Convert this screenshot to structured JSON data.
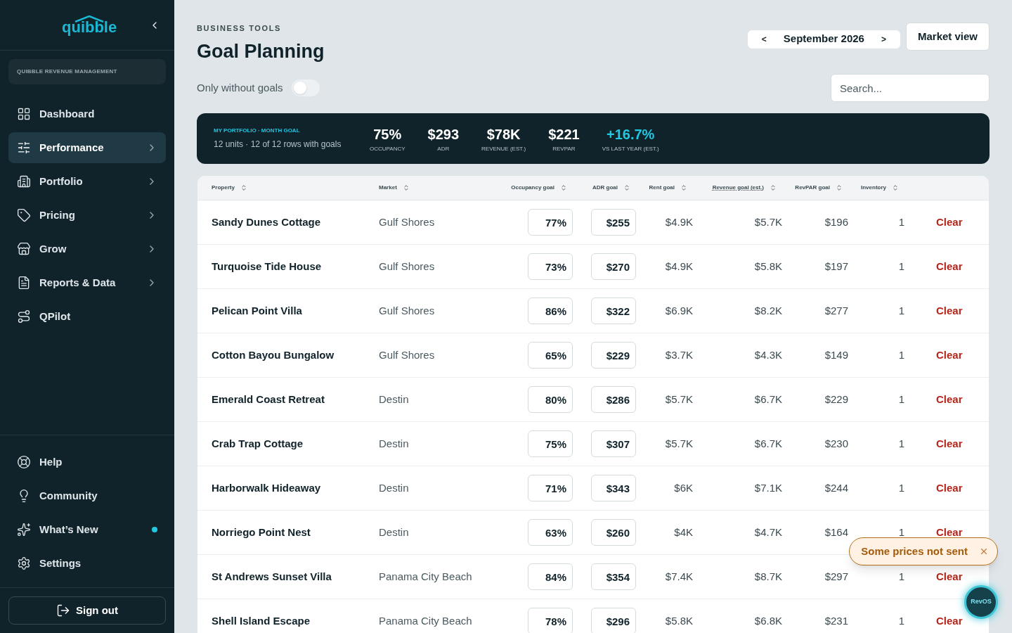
{
  "sidebar": {
    "logo": "quibble",
    "workspace": "QUIBBLE REVENUE MANAGEMENT",
    "items": [
      {
        "label": "Dashboard",
        "has_submenu": false,
        "selected": false
      },
      {
        "label": "Performance",
        "has_submenu": true,
        "selected": true
      },
      {
        "label": "Portfolio",
        "has_submenu": true,
        "selected": false
      },
      {
        "label": "Pricing",
        "has_submenu": true,
        "selected": false
      },
      {
        "label": "Grow",
        "has_submenu": true,
        "selected": false
      },
      {
        "label": "Reports & Data",
        "has_submenu": true,
        "selected": false
      },
      {
        "label": "QPilot",
        "has_submenu": false,
        "selected": false
      }
    ],
    "bottom_items": [
      {
        "label": "Help",
        "unread": false
      },
      {
        "label": "Community",
        "unread": false
      },
      {
        "label": "What’s New",
        "unread": true
      },
      {
        "label": "Settings",
        "unread": false
      }
    ],
    "sign_out": "Sign out"
  },
  "header": {
    "eyebrow": "BUSINESS TOOLS",
    "title": "Goal Planning",
    "prev": "<",
    "month": "September 2026",
    "next": ">",
    "market_view": "Market view"
  },
  "filter": {
    "label": "Only without goals",
    "on": false
  },
  "search": {
    "placeholder": "Search..."
  },
  "summary": {
    "title": "MY PORTFOLIO · MONTH GOAL",
    "subtitle": "12 units · 12 of 12 rows with goals",
    "metrics": [
      {
        "value": "75%",
        "label": "OCCUPANCY",
        "highlight": false
      },
      {
        "value": "$293",
        "label": "ADR",
        "highlight": false
      },
      {
        "value": "$78K",
        "label": "REVENUE (EST.)",
        "highlight": false
      },
      {
        "value": "$221",
        "label": "REVPAR",
        "highlight": false
      },
      {
        "value": "+16.7%",
        "label": "VS LAST YEAR (EST.)",
        "highlight": true
      }
    ]
  },
  "table": {
    "columns": [
      {
        "label": "Property",
        "dotted": false
      },
      {
        "label": "Market",
        "dotted": false
      },
      {
        "label": "Occupancy goal",
        "dotted": false
      },
      {
        "label": "ADR goal",
        "dotted": false
      },
      {
        "label": "Rent goal",
        "dotted": false
      },
      {
        "label": "Revenue goal (est.)",
        "dotted": true
      },
      {
        "label": "RevPAR goal",
        "dotted": false
      },
      {
        "label": "Inventory",
        "dotted": false
      }
    ],
    "rows": [
      {
        "property": "Sandy Dunes Cottage",
        "market": "Gulf Shores",
        "occupancy": "77%",
        "adr": "$255",
        "rent": "$4.9K",
        "revenue": "$5.7K",
        "revpar": "$196",
        "inventory": "1",
        "action": "Clear"
      },
      {
        "property": "Turquoise Tide House",
        "market": "Gulf Shores",
        "occupancy": "73%",
        "adr": "$270",
        "rent": "$4.9K",
        "revenue": "$5.8K",
        "revpar": "$197",
        "inventory": "1",
        "action": "Clear"
      },
      {
        "property": "Pelican Point Villa",
        "market": "Gulf Shores",
        "occupancy": "86%",
        "adr": "$322",
        "rent": "$6.9K",
        "revenue": "$8.2K",
        "revpar": "$277",
        "inventory": "1",
        "action": "Clear"
      },
      {
        "property": "Cotton Bayou Bungalow",
        "market": "Gulf Shores",
        "occupancy": "65%",
        "adr": "$229",
        "rent": "$3.7K",
        "revenue": "$4.3K",
        "revpar": "$149",
        "inventory": "1",
        "action": "Clear"
      },
      {
        "property": "Emerald Coast Retreat",
        "market": "Destin",
        "occupancy": "80%",
        "adr": "$286",
        "rent": "$5.7K",
        "revenue": "$6.7K",
        "revpar": "$229",
        "inventory": "1",
        "action": "Clear"
      },
      {
        "property": "Crab Trap Cottage",
        "market": "Destin",
        "occupancy": "75%",
        "adr": "$307",
        "rent": "$5.7K",
        "revenue": "$6.7K",
        "revpar": "$230",
        "inventory": "1",
        "action": "Clear"
      },
      {
        "property": "Harborwalk Hideaway",
        "market": "Destin",
        "occupancy": "71%",
        "adr": "$343",
        "rent": "$6K",
        "revenue": "$7.1K",
        "revpar": "$244",
        "inventory": "1",
        "action": "Clear"
      },
      {
        "property": "Norriego Point Nest",
        "market": "Destin",
        "occupancy": "63%",
        "adr": "$260",
        "rent": "$4K",
        "revenue": "$4.7K",
        "revpar": "$164",
        "inventory": "1",
        "action": "Clear"
      },
      {
        "property": "St Andrews Sunset Villa",
        "market": "Panama City Beach",
        "occupancy": "84%",
        "adr": "$354",
        "rent": "$7.4K",
        "revenue": "$8.7K",
        "revpar": "$297",
        "inventory": "1",
        "action": "Clear"
      },
      {
        "property": "Shell Island Escape",
        "market": "Panama City Beach",
        "occupancy": "78%",
        "adr": "$296",
        "rent": "$5.8K",
        "revenue": "$6.8K",
        "revpar": "$231",
        "inventory": "1",
        "action": "Clear"
      }
    ]
  },
  "toast": {
    "message": "Some prices not sent"
  },
  "assistant": {
    "label": "RevOS"
  }
}
